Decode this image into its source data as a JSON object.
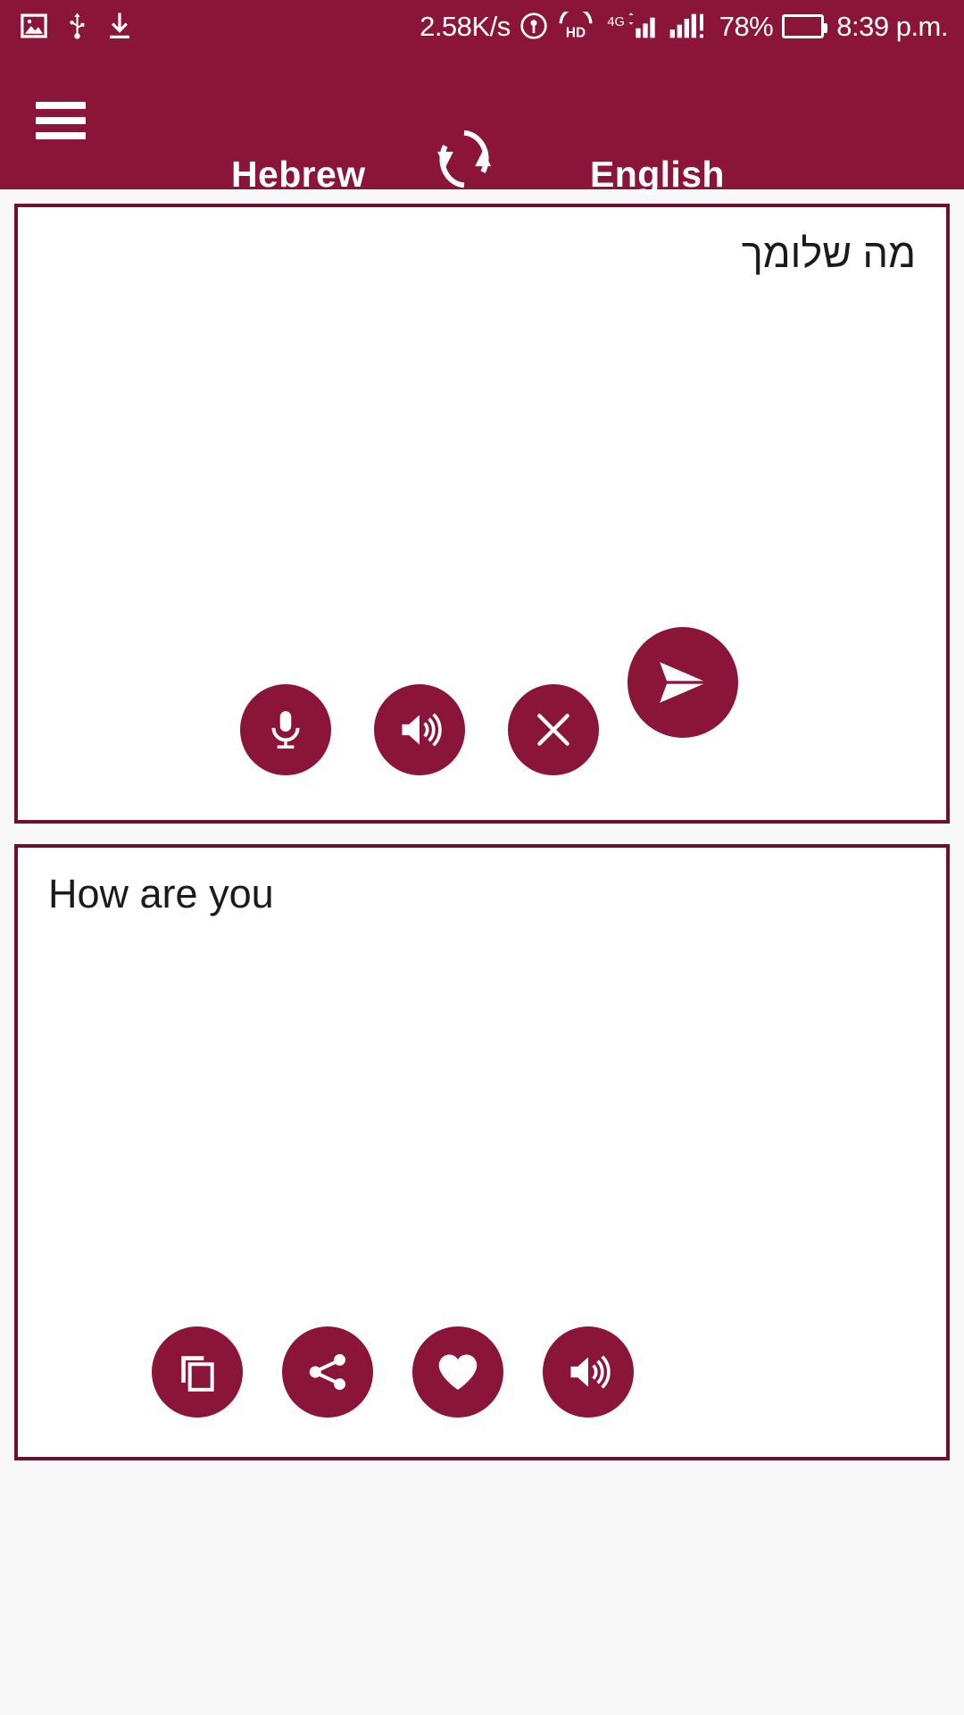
{
  "status_bar": {
    "left_icons": [
      "image-icon",
      "usb-icon",
      "download-icon"
    ],
    "network_speed": "2.58K/s",
    "hotspot_icon": "hotspot-icon",
    "volte_label": "HD",
    "network_type": "4G",
    "battery_percent": "78%",
    "battery_color": "#2fd400",
    "time": "8:39 p.m."
  },
  "app_bar": {
    "menu_icon": "hamburger-menu-icon",
    "source_language": "Hebrew",
    "swap_icon": "swap-languages-icon",
    "target_language": "English",
    "background_color": "#8b1538"
  },
  "source_card": {
    "text": "מה שלומך",
    "buttons": [
      {
        "name": "microphone-button",
        "icon": "microphone-icon"
      },
      {
        "name": "speak-source-button",
        "icon": "speaker-icon"
      },
      {
        "name": "clear-text-button",
        "icon": "close-icon"
      }
    ]
  },
  "translate_button": {
    "name": "translate-send-button",
    "icon": "send-icon"
  },
  "target_card": {
    "text": "How are you",
    "buttons": [
      {
        "name": "copy-button",
        "icon": "copy-icon"
      },
      {
        "name": "share-button",
        "icon": "share-icon"
      },
      {
        "name": "favorite-button",
        "icon": "heart-icon"
      },
      {
        "name": "speak-target-button",
        "icon": "speaker-icon"
      }
    ]
  },
  "theme": {
    "accent": "#8b1538",
    "card_border": "#6f1030",
    "card_background": "#ffffff",
    "page_background": "#f8f8f8"
  }
}
